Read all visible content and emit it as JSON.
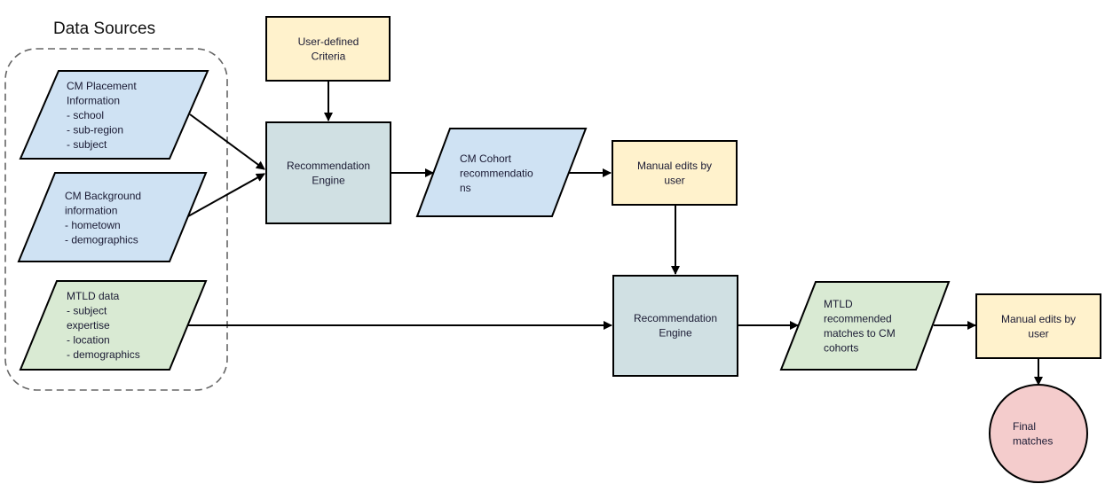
{
  "title": "Data Sources",
  "colors": {
    "blue": "#cfe2f3",
    "green": "#d9ead3",
    "yellow": "#fff2cc",
    "gray": "#d0e0e3",
    "red": "#f4cccc",
    "stroke": "#000000",
    "dash": "#666666"
  },
  "nodes": {
    "cm_placement": {
      "shape": "data",
      "lines": [
        "CM Placement",
        "Information",
        "- school",
        "- sub-region",
        "- subject"
      ]
    },
    "cm_background": {
      "shape": "data",
      "lines": [
        "CM Background",
        "information",
        "- hometown",
        "- demographics"
      ]
    },
    "mtld_data": {
      "shape": "data",
      "lines": [
        "MTLD data",
        "- subject",
        "expertise",
        "- location",
        "- demographics"
      ]
    },
    "user_criteria": {
      "shape": "process",
      "lines": [
        "User-defined",
        "Criteria"
      ]
    },
    "engine1": {
      "shape": "process",
      "lines": [
        "Recommendation",
        "Engine"
      ]
    },
    "cohort_recs": {
      "shape": "data",
      "lines": [
        "CM Cohort",
        "recommendatio",
        "ns"
      ]
    },
    "manual_edits1": {
      "shape": "process",
      "lines": [
        "Manual edits by",
        "user"
      ]
    },
    "engine2": {
      "shape": "process",
      "lines": [
        "Recommendation",
        "Engine"
      ]
    },
    "mtld_matches": {
      "shape": "data",
      "lines": [
        "MTLD",
        "recommended",
        "matches to CM",
        "cohorts"
      ]
    },
    "manual_edits2": {
      "shape": "process",
      "lines": [
        "Manual edits by",
        "user"
      ]
    },
    "final": {
      "shape": "terminal",
      "lines": [
        "Final",
        "matches"
      ]
    }
  },
  "edges": [
    [
      "cm_placement",
      "engine1"
    ],
    [
      "cm_background",
      "engine1"
    ],
    [
      "user_criteria",
      "engine1"
    ],
    [
      "engine1",
      "cohort_recs"
    ],
    [
      "cohort_recs",
      "manual_edits1"
    ],
    [
      "manual_edits1",
      "engine2"
    ],
    [
      "mtld_data",
      "engine2"
    ],
    [
      "engine2",
      "mtld_matches"
    ],
    [
      "mtld_matches",
      "manual_edits2"
    ],
    [
      "manual_edits2",
      "final"
    ]
  ]
}
